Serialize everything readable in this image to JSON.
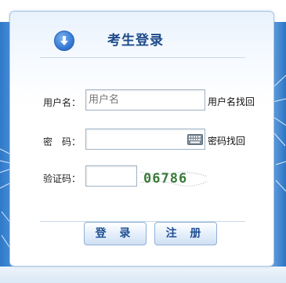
{
  "login_panel": {
    "title": "考生登录",
    "username": {
      "label": "用户名：",
      "placeholder": "用户名",
      "recover_link": "用户名找回"
    },
    "password": {
      "label": "密　码：",
      "value": "",
      "recover_link": "密码找回"
    },
    "captcha": {
      "label": "验证码：",
      "value": "",
      "image_text": "06786"
    },
    "buttons": {
      "login": "登 录",
      "register": "注 册"
    }
  },
  "colors": {
    "title": "#1d4a8a",
    "button_text": "#1f4f94",
    "border": "#a9c7e6",
    "background_blue": "#3a7fd8"
  },
  "icons": [
    "download-arrow-icon",
    "keyboard-icon"
  ]
}
